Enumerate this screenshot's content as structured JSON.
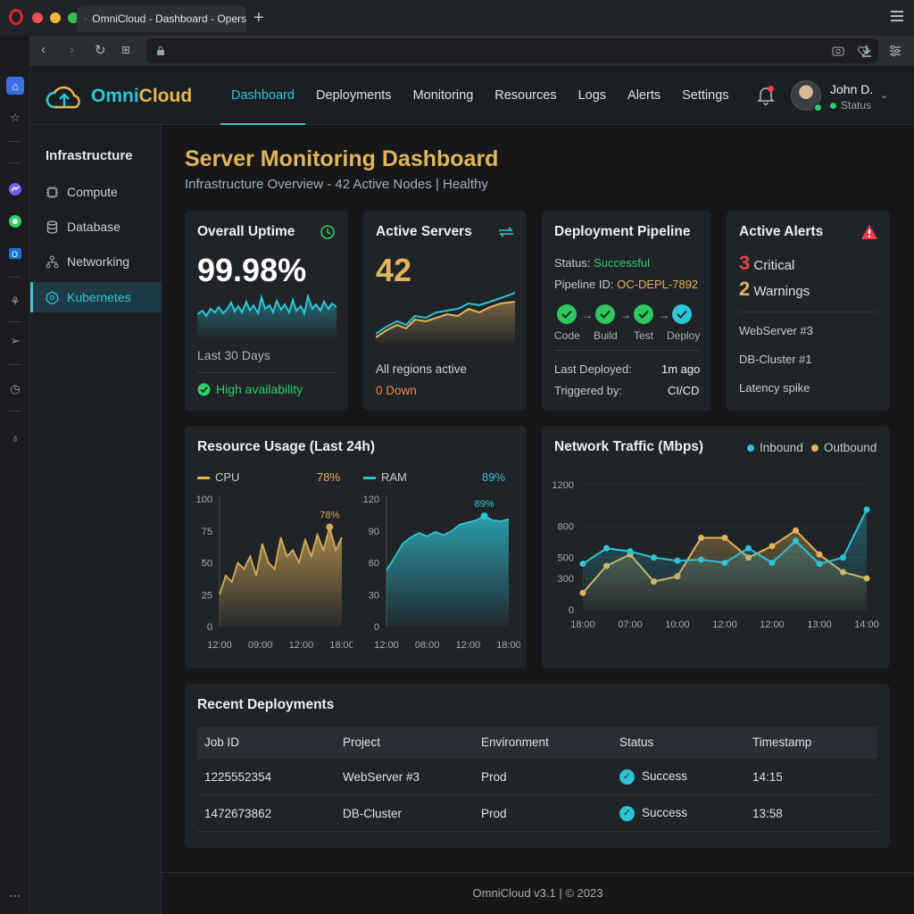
{
  "browser": {
    "tab_title": "OmniCloud - Dashboard - Opers",
    "new_tab": "+"
  },
  "app": {
    "brand_omni": "Omni",
    "brand_cloud": "Cloud",
    "nav": [
      "Dashboard",
      "Deployments",
      "Monitoring",
      "Resources",
      "Logs",
      "Alerts",
      "Settings"
    ],
    "active_nav": "Dashboard",
    "user_name": "John D.",
    "user_status": "Status"
  },
  "sidebar": {
    "heading": "Infrastructure",
    "items": [
      {
        "label": "Compute",
        "icon": "chip-icon"
      },
      {
        "label": "Database",
        "icon": "database-icon"
      },
      {
        "label": "Networking",
        "icon": "network-icon"
      },
      {
        "label": "Kubernetes",
        "icon": "kubernetes-icon"
      }
    ],
    "active": "Kubernetes"
  },
  "page": {
    "title": "Server Monitoring Dashboard",
    "subtitle": "Infrastructure Overview - 42 Active Nodes | Healthy"
  },
  "uptime": {
    "title": "Overall Uptime",
    "value": "99.98%",
    "period": "Last 30 Days",
    "status": "High availability"
  },
  "servers": {
    "title": "Active Servers",
    "value": "42",
    "regions": "All regions active",
    "down": "0 Down"
  },
  "pipeline": {
    "title": "Deployment Pipeline",
    "status_label": "Status:",
    "status_value": "Successful",
    "id_label": "Pipeline ID:",
    "id_value": "OC-DEPL-7892",
    "stages": [
      "Code",
      "Build",
      "Test",
      "Deploy"
    ],
    "last_label": "Last Deployed:",
    "last_value": "1m ago",
    "trigger_label": "Triggered by:",
    "trigger_value": "CI/CD"
  },
  "alerts": {
    "title": "Active Alerts",
    "critical_count": "3",
    "critical_label": "Critical",
    "warning_count": "2",
    "warning_label": "Warnings",
    "items": [
      "WebServer #3",
      "DB-Cluster #1",
      "Latency spike"
    ]
  },
  "resources": {
    "title": "Resource Usage (Last 24h)",
    "cpu_label": "CPU",
    "cpu_value": "78%",
    "ram_label": "RAM",
    "ram_value": "89%"
  },
  "network": {
    "title": "Network Traffic (Mbps)",
    "inbound": "Inbound",
    "outbound": "Outbound"
  },
  "deployments": {
    "title": "Recent Deployments",
    "columns": [
      "Job ID",
      "Project",
      "Environment",
      "Status",
      "Timestamp"
    ],
    "rows": [
      [
        "1225552354",
        "WebServer #3",
        "Prod",
        "Success",
        "14:15"
      ],
      [
        "1472673862",
        "DB-Cluster",
        "Prod",
        "Success",
        "13:58"
      ]
    ]
  },
  "footer": "OmniCloud v3.1 | © 2023",
  "colors": {
    "accent_cyan": "#35c4d4",
    "accent_gold": "#e3b45a",
    "success": "#2ed06a",
    "critical": "#e9414b"
  },
  "chart_data": [
    {
      "type": "area",
      "title": "CPU",
      "categories": [
        "12:00",
        "09:00",
        "12:00",
        "18:00"
      ],
      "ylim": [
        0,
        100
      ],
      "yticks": [
        0,
        25,
        50,
        75,
        100
      ],
      "values": [
        25,
        40,
        35,
        50,
        45,
        55,
        40,
        65,
        50,
        45,
        70,
        55,
        60,
        50,
        68,
        55,
        72,
        60,
        78,
        60,
        70
      ],
      "annotation": "78%"
    },
    {
      "type": "area",
      "title": "RAM",
      "categories": [
        "12:00",
        "08:00",
        "12:00",
        "18:00"
      ],
      "ylim": [
        0,
        120
      ],
      "yticks": [
        0,
        30,
        60,
        90,
        120
      ],
      "values": [
        53,
        65,
        78,
        84,
        88,
        85,
        89,
        86,
        90,
        96,
        98,
        100,
        104,
        100,
        99,
        101
      ],
      "annotation": "89%"
    },
    {
      "type": "line",
      "title": "Network Traffic (Mbps)",
      "categories": [
        "18:00",
        "07:00",
        "10:00",
        "12:00",
        "12:00",
        "13:00",
        "14:00"
      ],
      "ylim": [
        0,
        1200
      ],
      "yticks": [
        0,
        300,
        500,
        800,
        1200
      ],
      "series": [
        {
          "name": "Inbound",
          "values": [
            440,
            590,
            560,
            500,
            470,
            480,
            450,
            590,
            450,
            660,
            440,
            500,
            960
          ]
        },
        {
          "name": "Outbound",
          "values": [
            160,
            420,
            530,
            270,
            320,
            690,
            690,
            500,
            610,
            760,
            530,
            360,
            300
          ]
        }
      ]
    }
  ]
}
